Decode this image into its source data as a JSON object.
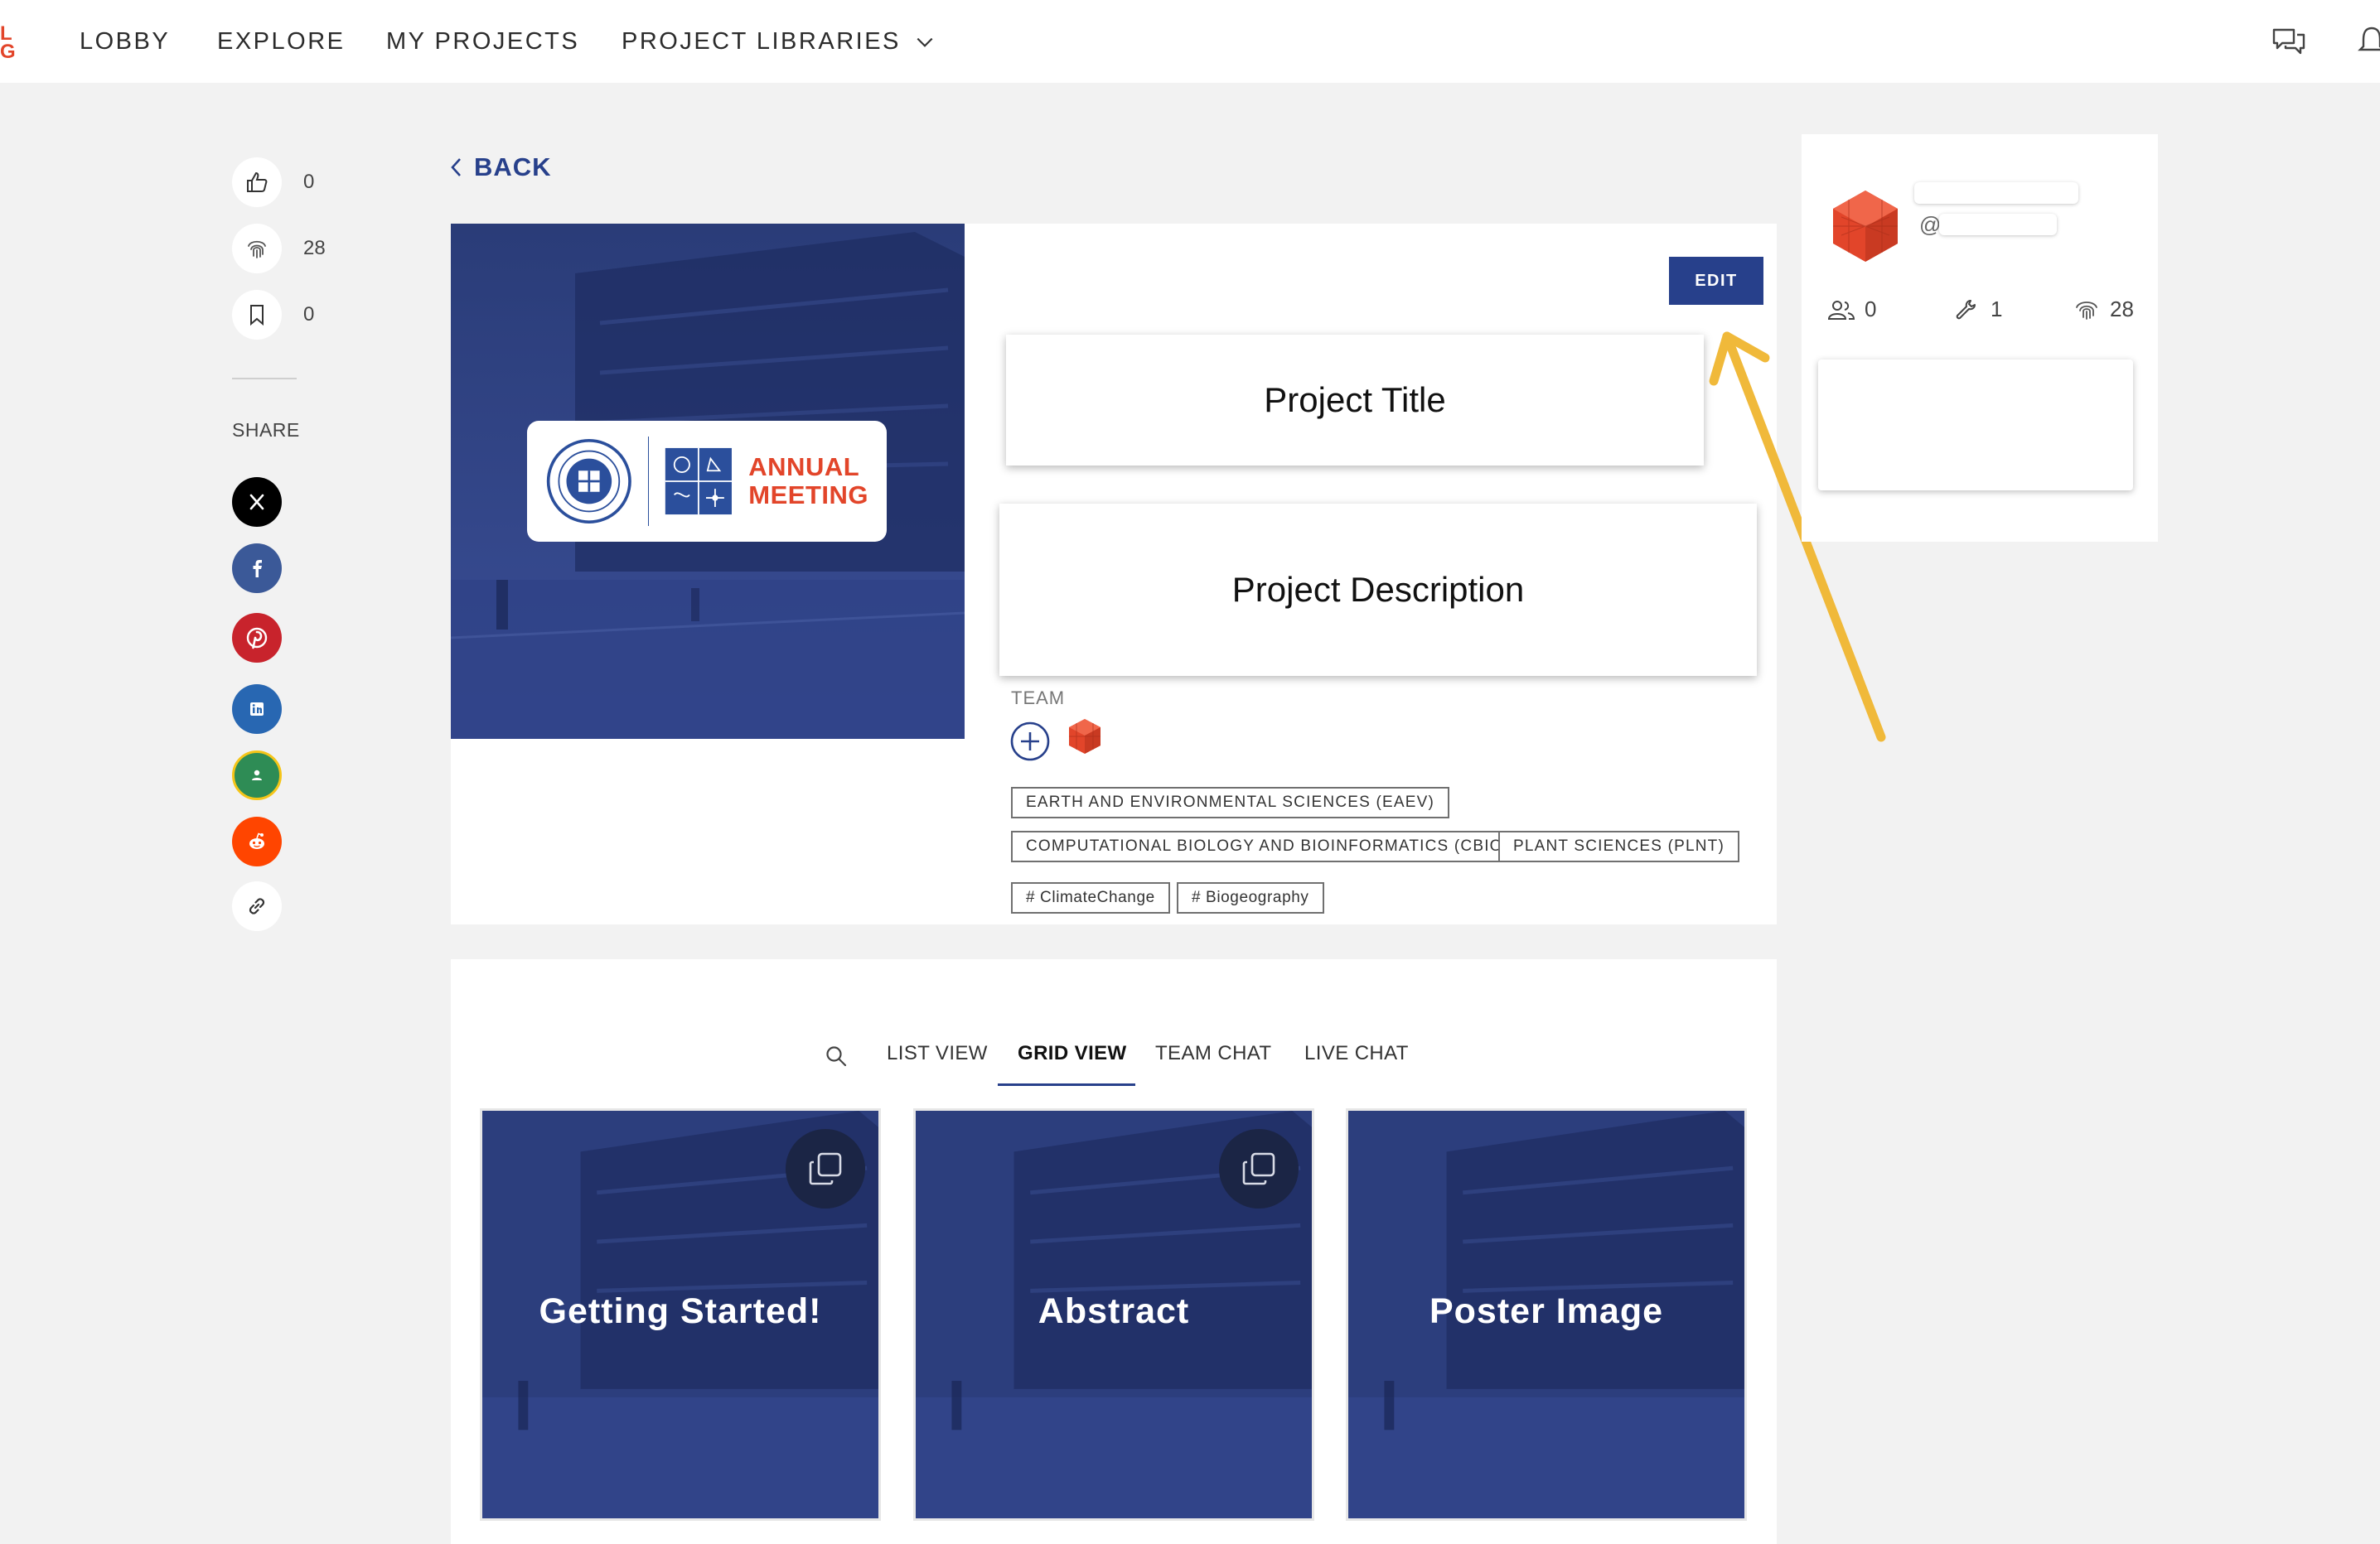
{
  "nav": {
    "brand_text": "L\nG",
    "items": [
      {
        "label": "LOBBY"
      },
      {
        "label": "EXPLORE"
      },
      {
        "label": "MY PROJECTS"
      },
      {
        "label": "PROJECT LIBRARIES"
      }
    ]
  },
  "rail": {
    "likes": "0",
    "views": "28",
    "bookmarks": "0",
    "share_label": "SHARE",
    "social": [
      {
        "name": "x",
        "color": "#000000"
      },
      {
        "name": "facebook",
        "color": "#3b5998"
      },
      {
        "name": "pinterest",
        "color": "#c8232c"
      },
      {
        "name": "linkedin",
        "color": "#2867b2"
      },
      {
        "name": "google-classroom",
        "color": "#2e8c55"
      },
      {
        "name": "reddit",
        "color": "#ff4500"
      },
      {
        "name": "copy-link",
        "color": "#ffffff"
      }
    ]
  },
  "back_label": "BACK",
  "project": {
    "logo_text_line1": "ANNUAL",
    "logo_text_line2": "MEETING",
    "edit_label": "EDIT",
    "title_placeholder": "Project Title",
    "description_placeholder": "Project Description",
    "team_label": "TEAM",
    "categories": [
      "EARTH AND ENVIRONMENTAL SCIENCES (EAEV)",
      "COMPUTATIONAL BIOLOGY AND BIOINFORMATICS (CBIO)",
      "PLANT SCIENCES (PLNT)"
    ],
    "hashtags": [
      "# ClimateChange",
      "# Biogeography"
    ]
  },
  "profile": {
    "handle_prefix": "@",
    "followers": "0",
    "projects": "1",
    "views": "28"
  },
  "tabs": {
    "items": [
      {
        "label": "LIST VIEW",
        "active": false
      },
      {
        "label": "GRID VIEW",
        "active": true
      },
      {
        "label": "TEAM CHAT",
        "active": false
      },
      {
        "label": "LIVE CHAT",
        "active": false
      }
    ]
  },
  "grid": {
    "cards": [
      {
        "title": "Getting Started!"
      },
      {
        "title": "Abstract"
      },
      {
        "title": "Poster Image"
      }
    ]
  },
  "colors": {
    "accent": "#27408b",
    "brand_red": "#e2452a",
    "annotation_arrow": "#f0b93a"
  }
}
